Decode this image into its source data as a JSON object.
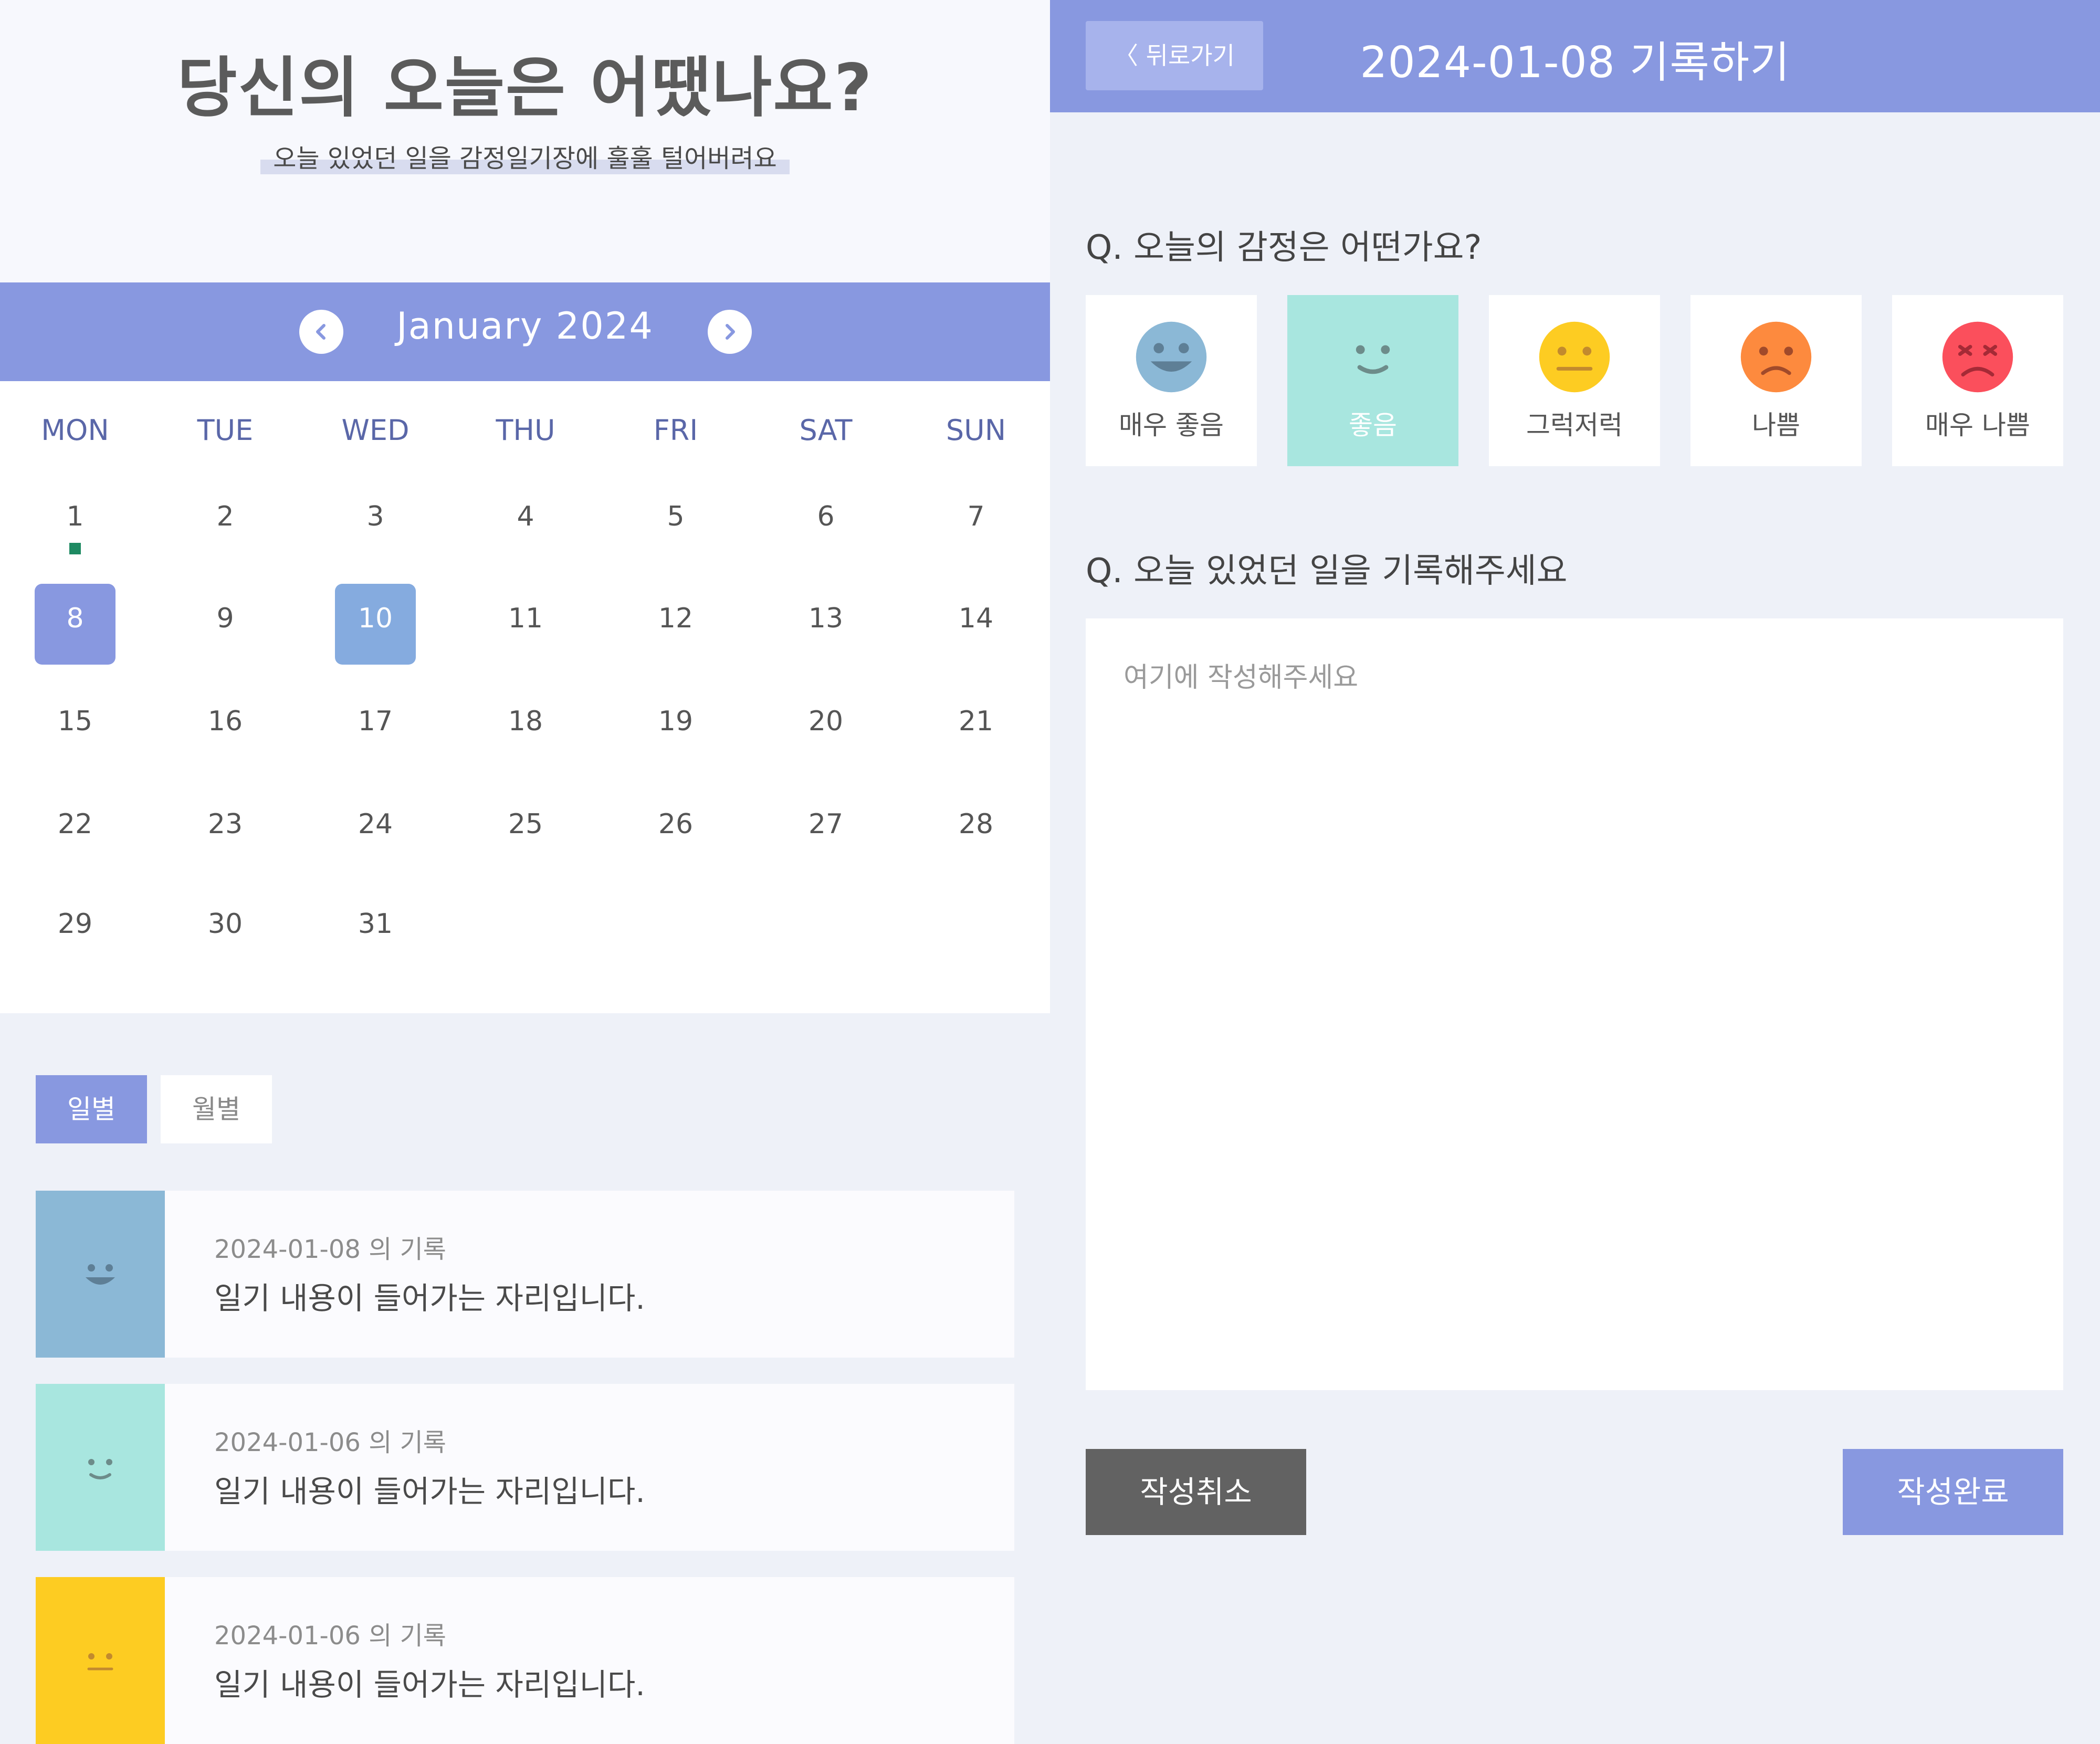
{
  "hero": {
    "title": "당신의 오늘은 어땠나요?",
    "subtitle": "오늘 있었던 일을 감정일기장에 훌훌 털어버려요"
  },
  "calendar": {
    "month_label": "January 2024",
    "weekdays": [
      "MON",
      "TUE",
      "WED",
      "THU",
      "FRI",
      "SAT",
      "SUN"
    ],
    "days": [
      "1",
      "2",
      "3",
      "4",
      "5",
      "6",
      "7",
      "8",
      "9",
      "10",
      "11",
      "12",
      "13",
      "14",
      "15",
      "16",
      "17",
      "18",
      "19",
      "20",
      "21",
      "22",
      "23",
      "24",
      "25",
      "26",
      "27",
      "28",
      "29",
      "30",
      "31"
    ],
    "selected_day": "8",
    "highlighted_day": "10",
    "marked_day": "1"
  },
  "tabs": {
    "daily": "일별",
    "monthly": "월별",
    "active": "daily"
  },
  "entries": [
    {
      "date": "2024-01-08 의 기록",
      "text": "일기 내용이 들어가는 자리입니다.",
      "mood": "very-good"
    },
    {
      "date": "2024-01-06 의 기록",
      "text": "일기 내용이 들어가는 자리입니다.",
      "mood": "good"
    },
    {
      "date": "2024-01-06 의 기록",
      "text": "일기 내용이 들어가는 자리입니다.",
      "mood": "neutral"
    }
  ],
  "editor": {
    "back_label": "〈 뒤로가기",
    "title": "2024-01-08 기록하기",
    "q_emotion": "Q. 오늘의 감정은 어떤가요?",
    "q_record": "Q. 오늘 있었던 일을 기록해주세요",
    "placeholder": "여기에 작성해주세요",
    "cancel_label": "작성취소",
    "submit_label": "작성완료",
    "selected_emotion": "good"
  },
  "emotions": [
    {
      "key": "very-good",
      "label": "매우 좋음",
      "icon": "grinning-face-icon",
      "color": "#8bb8d6"
    },
    {
      "key": "good",
      "label": "좋음",
      "icon": "smiling-face-icon",
      "color": "#a8e6df"
    },
    {
      "key": "neutral",
      "label": "그럭저럭",
      "icon": "neutral-face-icon",
      "color": "#fdcc22"
    },
    {
      "key": "bad",
      "label": "나쁨",
      "icon": "frowning-face-icon",
      "color": "#fd8a3e"
    },
    {
      "key": "very-bad",
      "label": "매우 나쁨",
      "icon": "angry-face-icon",
      "color": "#fb4f5c"
    }
  ],
  "colors": {
    "accent": "#8898e0",
    "selected_emotion_bg": "#a8e6df",
    "highlight_day": "#85abdf",
    "marker": "#1e8a62",
    "cancel": "#626262"
  }
}
